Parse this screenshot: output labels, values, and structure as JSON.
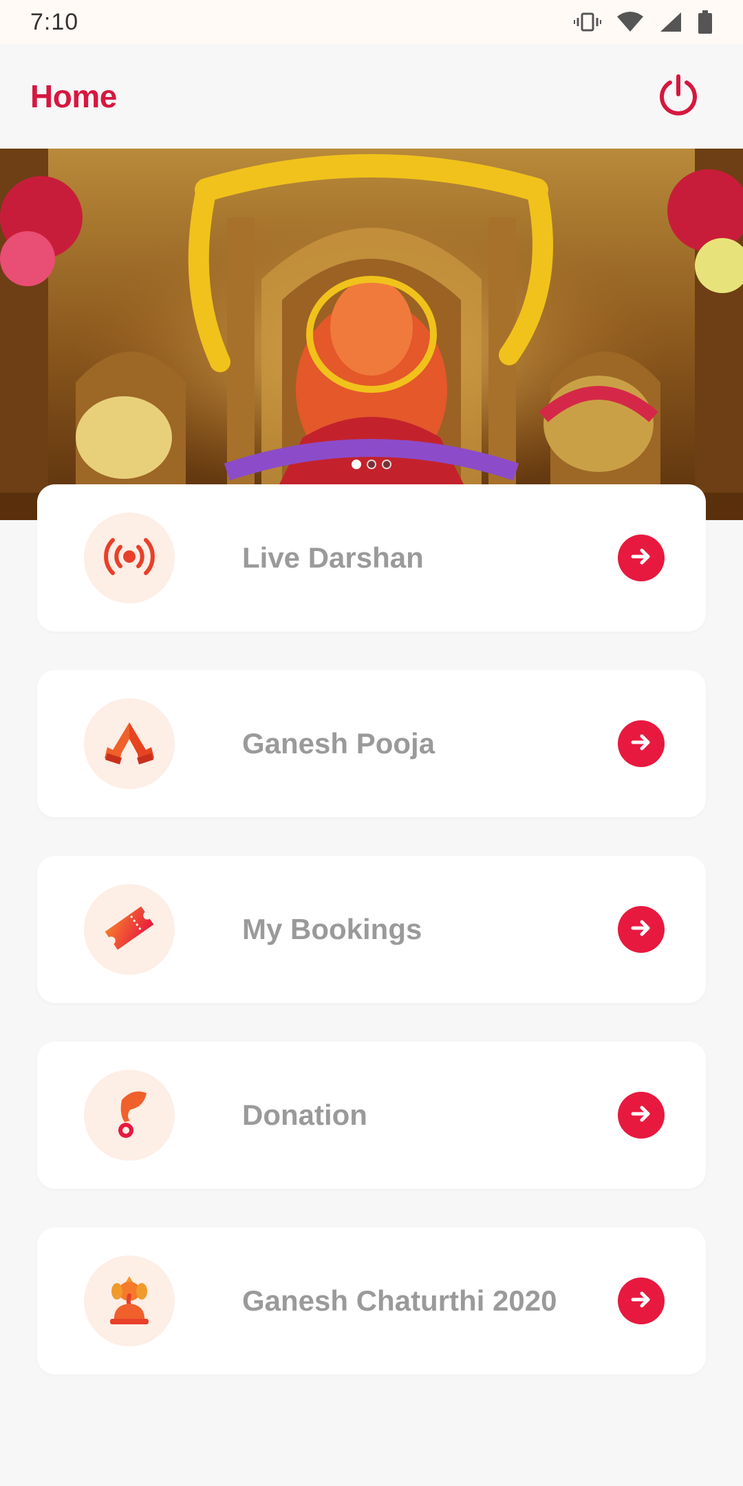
{
  "status_bar": {
    "time": "7:10",
    "icons": [
      "vibrate-icon",
      "wifi-icon",
      "signal-icon",
      "battery-icon"
    ]
  },
  "header": {
    "title": "Home",
    "power_icon": "power-icon"
  },
  "banner": {
    "description_icon": "temple-idol-photo",
    "pager": {
      "count": 3,
      "active_index": 0
    }
  },
  "menu": {
    "items": [
      {
        "label": "Live Darshan",
        "icon": "live-broadcast-icon",
        "arrow_icon": "arrow-right-icon"
      },
      {
        "label": "Ganesh Pooja",
        "icon": "praying-hands-icon",
        "arrow_icon": "arrow-right-icon"
      },
      {
        "label": "My Bookings",
        "icon": "ticket-icon",
        "arrow_icon": "arrow-right-icon"
      },
      {
        "label": "Donation",
        "icon": "donation-hand-icon",
        "arrow_icon": "arrow-right-icon"
      },
      {
        "label": "Ganesh Chaturthi 2020",
        "icon": "ganesh-idol-icon",
        "arrow_icon": "arrow-right-icon"
      }
    ]
  },
  "colors": {
    "accent": "#d6173f",
    "arrow_button": "#e8193f",
    "icon_background": "#fdeee6",
    "icon_orange": "#f0602a",
    "page_background": "#f7f7f7",
    "label_gray": "#9a9a9a"
  }
}
